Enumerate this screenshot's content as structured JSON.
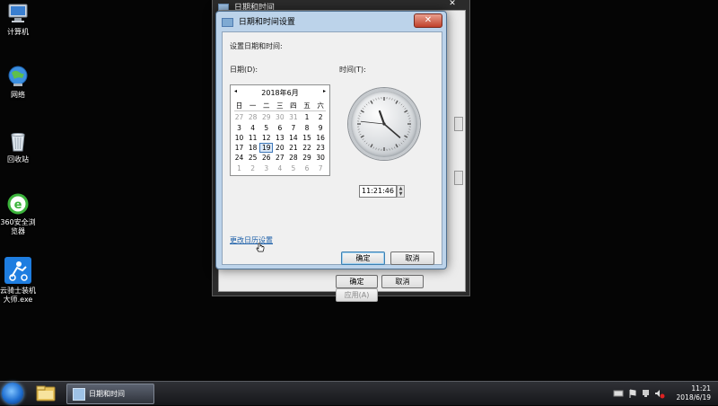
{
  "desktop": {
    "icons": [
      {
        "label": "计算机"
      },
      {
        "label": "网络"
      },
      {
        "label": "回收站"
      },
      {
        "label": "360安全浏览器"
      },
      {
        "label": "云骑士装机大师.exe"
      }
    ]
  },
  "outer_window": {
    "title": "日期和时间",
    "close_symbol": "✕",
    "buttons": {
      "ok": "确定",
      "cancel": "取消",
      "apply": "应用(A)"
    }
  },
  "dialog": {
    "title": "日期和时间设置",
    "close_symbol": "✕",
    "heading": "设置日期和时间:",
    "date_label": "日期(D):",
    "time_label": "时间(T):",
    "calendar": {
      "month_label": "2018年6月",
      "prev_symbol": "◂",
      "next_symbol": "▸",
      "weekdays": [
        "日",
        "一",
        "二",
        "三",
        "四",
        "五",
        "六"
      ],
      "weeks": [
        [
          "27",
          "28",
          "29",
          "30",
          "31",
          "1",
          "2"
        ],
        [
          "3",
          "4",
          "5",
          "6",
          "7",
          "8",
          "9"
        ],
        [
          "10",
          "11",
          "12",
          "13",
          "14",
          "15",
          "16"
        ],
        [
          "17",
          "18",
          "19",
          "20",
          "21",
          "22",
          "23"
        ],
        [
          "24",
          "25",
          "26",
          "27",
          "28",
          "29",
          "30"
        ],
        [
          "1",
          "2",
          "3",
          "4",
          "5",
          "6",
          "7"
        ]
      ],
      "selected_day": "19"
    },
    "clock": {
      "hour": 11,
      "minute": 21,
      "second": 46
    },
    "time_value": "11:21:46",
    "spin_up": "▲",
    "spin_down": "▼",
    "calendar_settings_link": "更改日历设置",
    "buttons": {
      "ok": "确定",
      "cancel": "取消"
    }
  },
  "taskbar": {
    "active_task": "日期和时间",
    "clock_time": "11:21",
    "clock_date": "2018/6/19"
  }
}
